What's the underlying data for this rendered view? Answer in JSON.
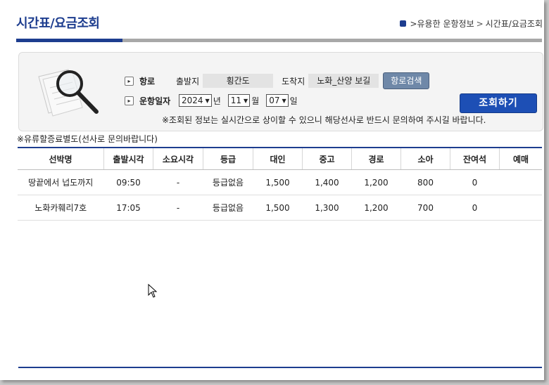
{
  "page": {
    "title": "시간표/요금조회",
    "breadcrumb": [
      ">유용한 운항정보",
      ">",
      "시간표/요금조회"
    ]
  },
  "search": {
    "route_label": "항로",
    "departure_label": "출발지",
    "departure_value": "횡간도",
    "arrival_label": "도착지",
    "arrival_value": "노화_산양 보길",
    "route_search_button": "항로검색",
    "date_label": "운항일자",
    "year": "2024",
    "year_unit": "년",
    "month": "11",
    "month_unit": "월",
    "day": "07",
    "day_unit": "일",
    "submit_button": "조회하기",
    "notice": "※조회된 정보는 실시간으로 상이할 수 있으니 해당선사로 반드시 문의하여 주시길 바랍니다."
  },
  "fuel_note": "※유류할증료별도(선사로 문의바랍니다)",
  "table": {
    "headers": [
      "선박명",
      "출발시각",
      "소요시각",
      "등급",
      "대인",
      "중고",
      "경로",
      "소아",
      "잔여석",
      "예매"
    ],
    "rows": [
      [
        "땅끝에서 넙도까지",
        "09:50",
        "-",
        "등급없음",
        "1,500",
        "1,400",
        "1,200",
        "800",
        "0",
        ""
      ],
      [
        "노화카훼리7호",
        "17:05",
        "-",
        "등급없음",
        "1,500",
        "1,300",
        "1,200",
        "700",
        "0",
        ""
      ]
    ]
  },
  "colors": {
    "accent": "#1d3d8f",
    "button": "#1d4fb5",
    "route_button": "#6f88a8"
  }
}
